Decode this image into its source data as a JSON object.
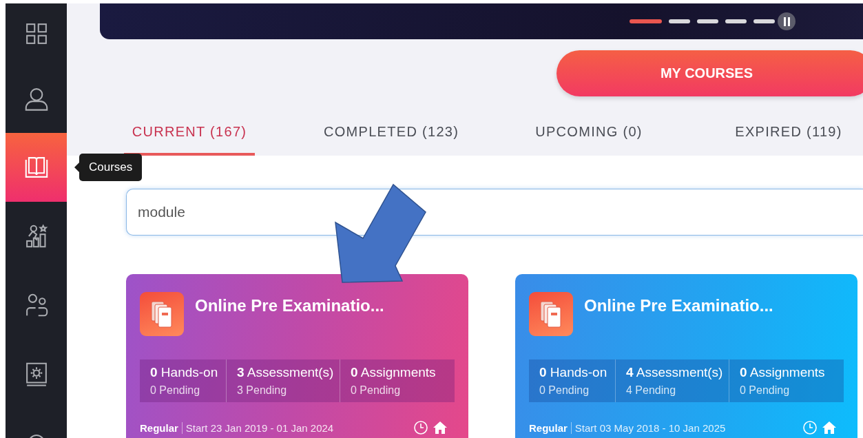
{
  "sidebar": {
    "items": [
      {
        "kind": "grid",
        "selected": false
      },
      {
        "kind": "user",
        "selected": false
      },
      {
        "kind": "book",
        "selected": true,
        "tooltip": "Courses"
      },
      {
        "kind": "achievement",
        "selected": false
      },
      {
        "kind": "users",
        "selected": false
      },
      {
        "kind": "settings",
        "selected": false
      },
      {
        "kind": "circle",
        "selected": false
      }
    ]
  },
  "banner": {
    "slides": [
      {
        "selected": true
      },
      {
        "selected": false
      },
      {
        "selected": false
      },
      {
        "selected": false
      },
      {
        "selected": false
      }
    ]
  },
  "my_courses_button": "MY COURSES",
  "tabs": [
    {
      "label": "CURRENT (167)",
      "selected": true
    },
    {
      "label": "COMPLETED (123)",
      "selected": false
    },
    {
      "label": "UPCOMING (0)",
      "selected": false
    },
    {
      "label": "EXPIRED (119)",
      "selected": false
    }
  ],
  "search": {
    "value": "module"
  },
  "cards": [
    {
      "kind": "purple",
      "title": "Online Pre Examinatio...",
      "stats": [
        {
          "count": "0",
          "label": "Hands-on",
          "pending": "0 Pending"
        },
        {
          "count": "3",
          "label": "Assessment(s)",
          "pending": "3 Pending"
        },
        {
          "count": "0",
          "label": "Assignments",
          "pending": "0 Pending"
        }
      ],
      "type": "Regular",
      "dates": "Start 23 Jan 2019 - 01 Jan 2024"
    },
    {
      "kind": "blue",
      "title": "Online Pre Examinatio...",
      "stats": [
        {
          "count": "0",
          "label": "Hands-on",
          "pending": "0 Pending"
        },
        {
          "count": "4",
          "label": "Assessment(s)",
          "pending": "4 Pending"
        },
        {
          "count": "0",
          "label": "Assignments",
          "pending": "0 Pending"
        }
      ],
      "type": "Regular",
      "dates": "Start 03 May 2018 - 10 Jan 2025"
    }
  ]
}
